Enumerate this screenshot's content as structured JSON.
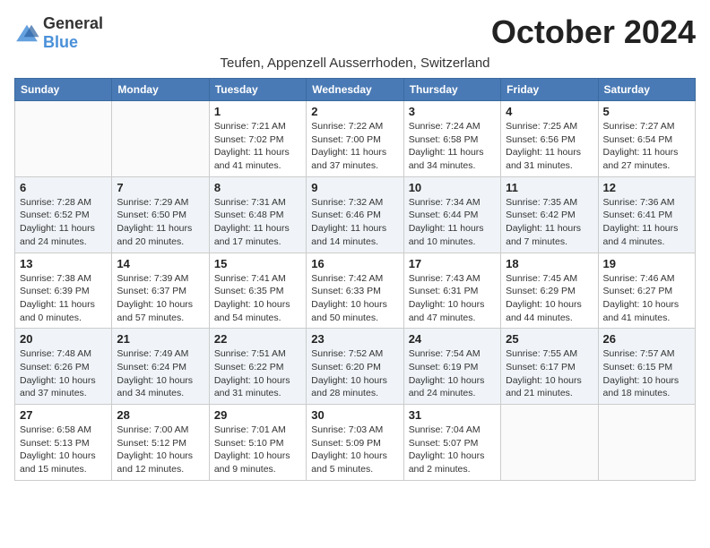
{
  "logo": {
    "general": "General",
    "blue": "Blue"
  },
  "title": "October 2024",
  "subtitle": "Teufen, Appenzell Ausserrhoden, Switzerland",
  "weekdays": [
    "Sunday",
    "Monday",
    "Tuesday",
    "Wednesday",
    "Thursday",
    "Friday",
    "Saturday"
  ],
  "weeks": [
    [
      {
        "day": "",
        "info": ""
      },
      {
        "day": "",
        "info": ""
      },
      {
        "day": "1",
        "info": "Sunrise: 7:21 AM\nSunset: 7:02 PM\nDaylight: 11 hours and 41 minutes."
      },
      {
        "day": "2",
        "info": "Sunrise: 7:22 AM\nSunset: 7:00 PM\nDaylight: 11 hours and 37 minutes."
      },
      {
        "day": "3",
        "info": "Sunrise: 7:24 AM\nSunset: 6:58 PM\nDaylight: 11 hours and 34 minutes."
      },
      {
        "day": "4",
        "info": "Sunrise: 7:25 AM\nSunset: 6:56 PM\nDaylight: 11 hours and 31 minutes."
      },
      {
        "day": "5",
        "info": "Sunrise: 7:27 AM\nSunset: 6:54 PM\nDaylight: 11 hours and 27 minutes."
      }
    ],
    [
      {
        "day": "6",
        "info": "Sunrise: 7:28 AM\nSunset: 6:52 PM\nDaylight: 11 hours and 24 minutes."
      },
      {
        "day": "7",
        "info": "Sunrise: 7:29 AM\nSunset: 6:50 PM\nDaylight: 11 hours and 20 minutes."
      },
      {
        "day": "8",
        "info": "Sunrise: 7:31 AM\nSunset: 6:48 PM\nDaylight: 11 hours and 17 minutes."
      },
      {
        "day": "9",
        "info": "Sunrise: 7:32 AM\nSunset: 6:46 PM\nDaylight: 11 hours and 14 minutes."
      },
      {
        "day": "10",
        "info": "Sunrise: 7:34 AM\nSunset: 6:44 PM\nDaylight: 11 hours and 10 minutes."
      },
      {
        "day": "11",
        "info": "Sunrise: 7:35 AM\nSunset: 6:42 PM\nDaylight: 11 hours and 7 minutes."
      },
      {
        "day": "12",
        "info": "Sunrise: 7:36 AM\nSunset: 6:41 PM\nDaylight: 11 hours and 4 minutes."
      }
    ],
    [
      {
        "day": "13",
        "info": "Sunrise: 7:38 AM\nSunset: 6:39 PM\nDaylight: 11 hours and 0 minutes."
      },
      {
        "day": "14",
        "info": "Sunrise: 7:39 AM\nSunset: 6:37 PM\nDaylight: 10 hours and 57 minutes."
      },
      {
        "day": "15",
        "info": "Sunrise: 7:41 AM\nSunset: 6:35 PM\nDaylight: 10 hours and 54 minutes."
      },
      {
        "day": "16",
        "info": "Sunrise: 7:42 AM\nSunset: 6:33 PM\nDaylight: 10 hours and 50 minutes."
      },
      {
        "day": "17",
        "info": "Sunrise: 7:43 AM\nSunset: 6:31 PM\nDaylight: 10 hours and 47 minutes."
      },
      {
        "day": "18",
        "info": "Sunrise: 7:45 AM\nSunset: 6:29 PM\nDaylight: 10 hours and 44 minutes."
      },
      {
        "day": "19",
        "info": "Sunrise: 7:46 AM\nSunset: 6:27 PM\nDaylight: 10 hours and 41 minutes."
      }
    ],
    [
      {
        "day": "20",
        "info": "Sunrise: 7:48 AM\nSunset: 6:26 PM\nDaylight: 10 hours and 37 minutes."
      },
      {
        "day": "21",
        "info": "Sunrise: 7:49 AM\nSunset: 6:24 PM\nDaylight: 10 hours and 34 minutes."
      },
      {
        "day": "22",
        "info": "Sunrise: 7:51 AM\nSunset: 6:22 PM\nDaylight: 10 hours and 31 minutes."
      },
      {
        "day": "23",
        "info": "Sunrise: 7:52 AM\nSunset: 6:20 PM\nDaylight: 10 hours and 28 minutes."
      },
      {
        "day": "24",
        "info": "Sunrise: 7:54 AM\nSunset: 6:19 PM\nDaylight: 10 hours and 24 minutes."
      },
      {
        "day": "25",
        "info": "Sunrise: 7:55 AM\nSunset: 6:17 PM\nDaylight: 10 hours and 21 minutes."
      },
      {
        "day": "26",
        "info": "Sunrise: 7:57 AM\nSunset: 6:15 PM\nDaylight: 10 hours and 18 minutes."
      }
    ],
    [
      {
        "day": "27",
        "info": "Sunrise: 6:58 AM\nSunset: 5:13 PM\nDaylight: 10 hours and 15 minutes."
      },
      {
        "day": "28",
        "info": "Sunrise: 7:00 AM\nSunset: 5:12 PM\nDaylight: 10 hours and 12 minutes."
      },
      {
        "day": "29",
        "info": "Sunrise: 7:01 AM\nSunset: 5:10 PM\nDaylight: 10 hours and 9 minutes."
      },
      {
        "day": "30",
        "info": "Sunrise: 7:03 AM\nSunset: 5:09 PM\nDaylight: 10 hours and 5 minutes."
      },
      {
        "day": "31",
        "info": "Sunrise: 7:04 AM\nSunset: 5:07 PM\nDaylight: 10 hours and 2 minutes."
      },
      {
        "day": "",
        "info": ""
      },
      {
        "day": "",
        "info": ""
      }
    ]
  ]
}
